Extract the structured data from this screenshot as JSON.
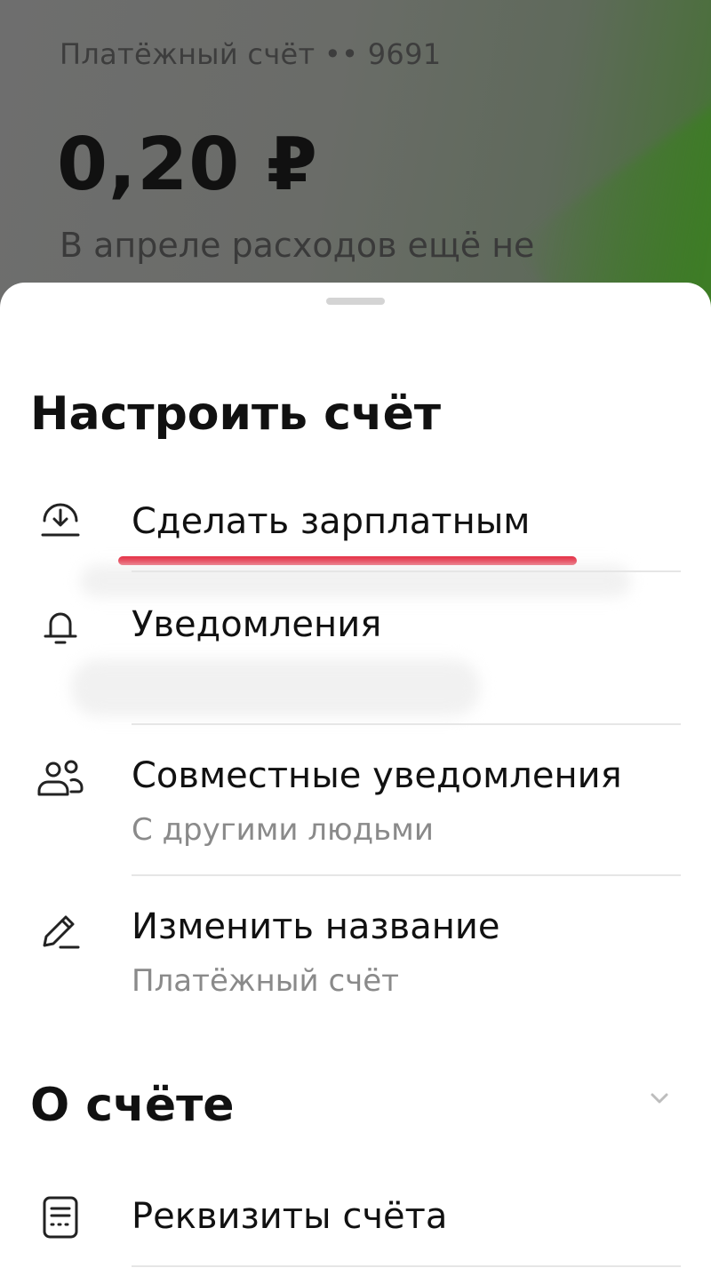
{
  "background": {
    "account_label": "Платёжный счёт •• 9691",
    "balance": "0,20 ₽",
    "spend_note": "В апреле расходов ещё не"
  },
  "sheet": {
    "title": "Настроить счёт",
    "items": [
      {
        "label": "Сделать зарплатным",
        "icon": "download-circle-icon",
        "highlighted": true
      },
      {
        "label": "Уведомления",
        "icon": "bell-icon"
      },
      {
        "label": "Совместные уведомления",
        "sub": "С другими людьми",
        "icon": "people-icon"
      },
      {
        "label": "Изменить название",
        "sub": "Платёжный счёт",
        "icon": "pencil-icon"
      }
    ],
    "about_title": "О счёте",
    "about_items": [
      {
        "label": "Реквизиты счёта",
        "icon": "document-icon"
      }
    ]
  },
  "colors": {
    "accent_underline": "#e41f36",
    "text_primary": "#111111",
    "text_secondary": "#8a8a8a"
  }
}
